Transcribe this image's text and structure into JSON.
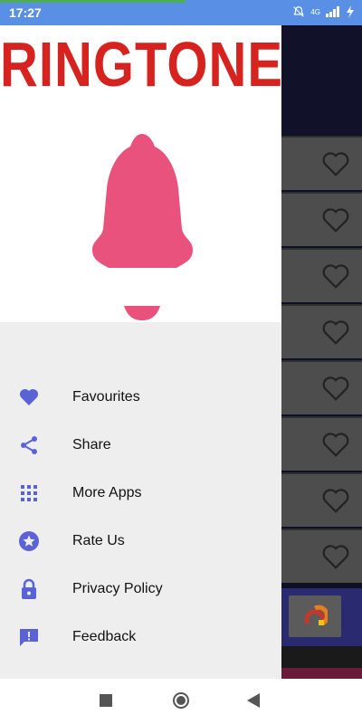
{
  "status": {
    "time": "17:27",
    "net": "4G"
  },
  "drawer": {
    "title": "RINGTONES",
    "menu": [
      {
        "label": "Favourites",
        "icon": "heart-icon"
      },
      {
        "label": "Share",
        "icon": "share-icon"
      },
      {
        "label": "More Apps",
        "icon": "apps-grid-icon"
      },
      {
        "label": "Rate Us",
        "icon": "star-circle-icon"
      },
      {
        "label": "Privacy Policy",
        "icon": "lock-icon"
      },
      {
        "label": "Feedback",
        "icon": "feedback-icon"
      }
    ]
  },
  "colors": {
    "status_bar": "#5a8fe6",
    "drawer_bg": "#eeeeee",
    "menu_icon": "#5a62d6",
    "title_red": "#d7231f",
    "bell_pink": "#e8527d"
  }
}
